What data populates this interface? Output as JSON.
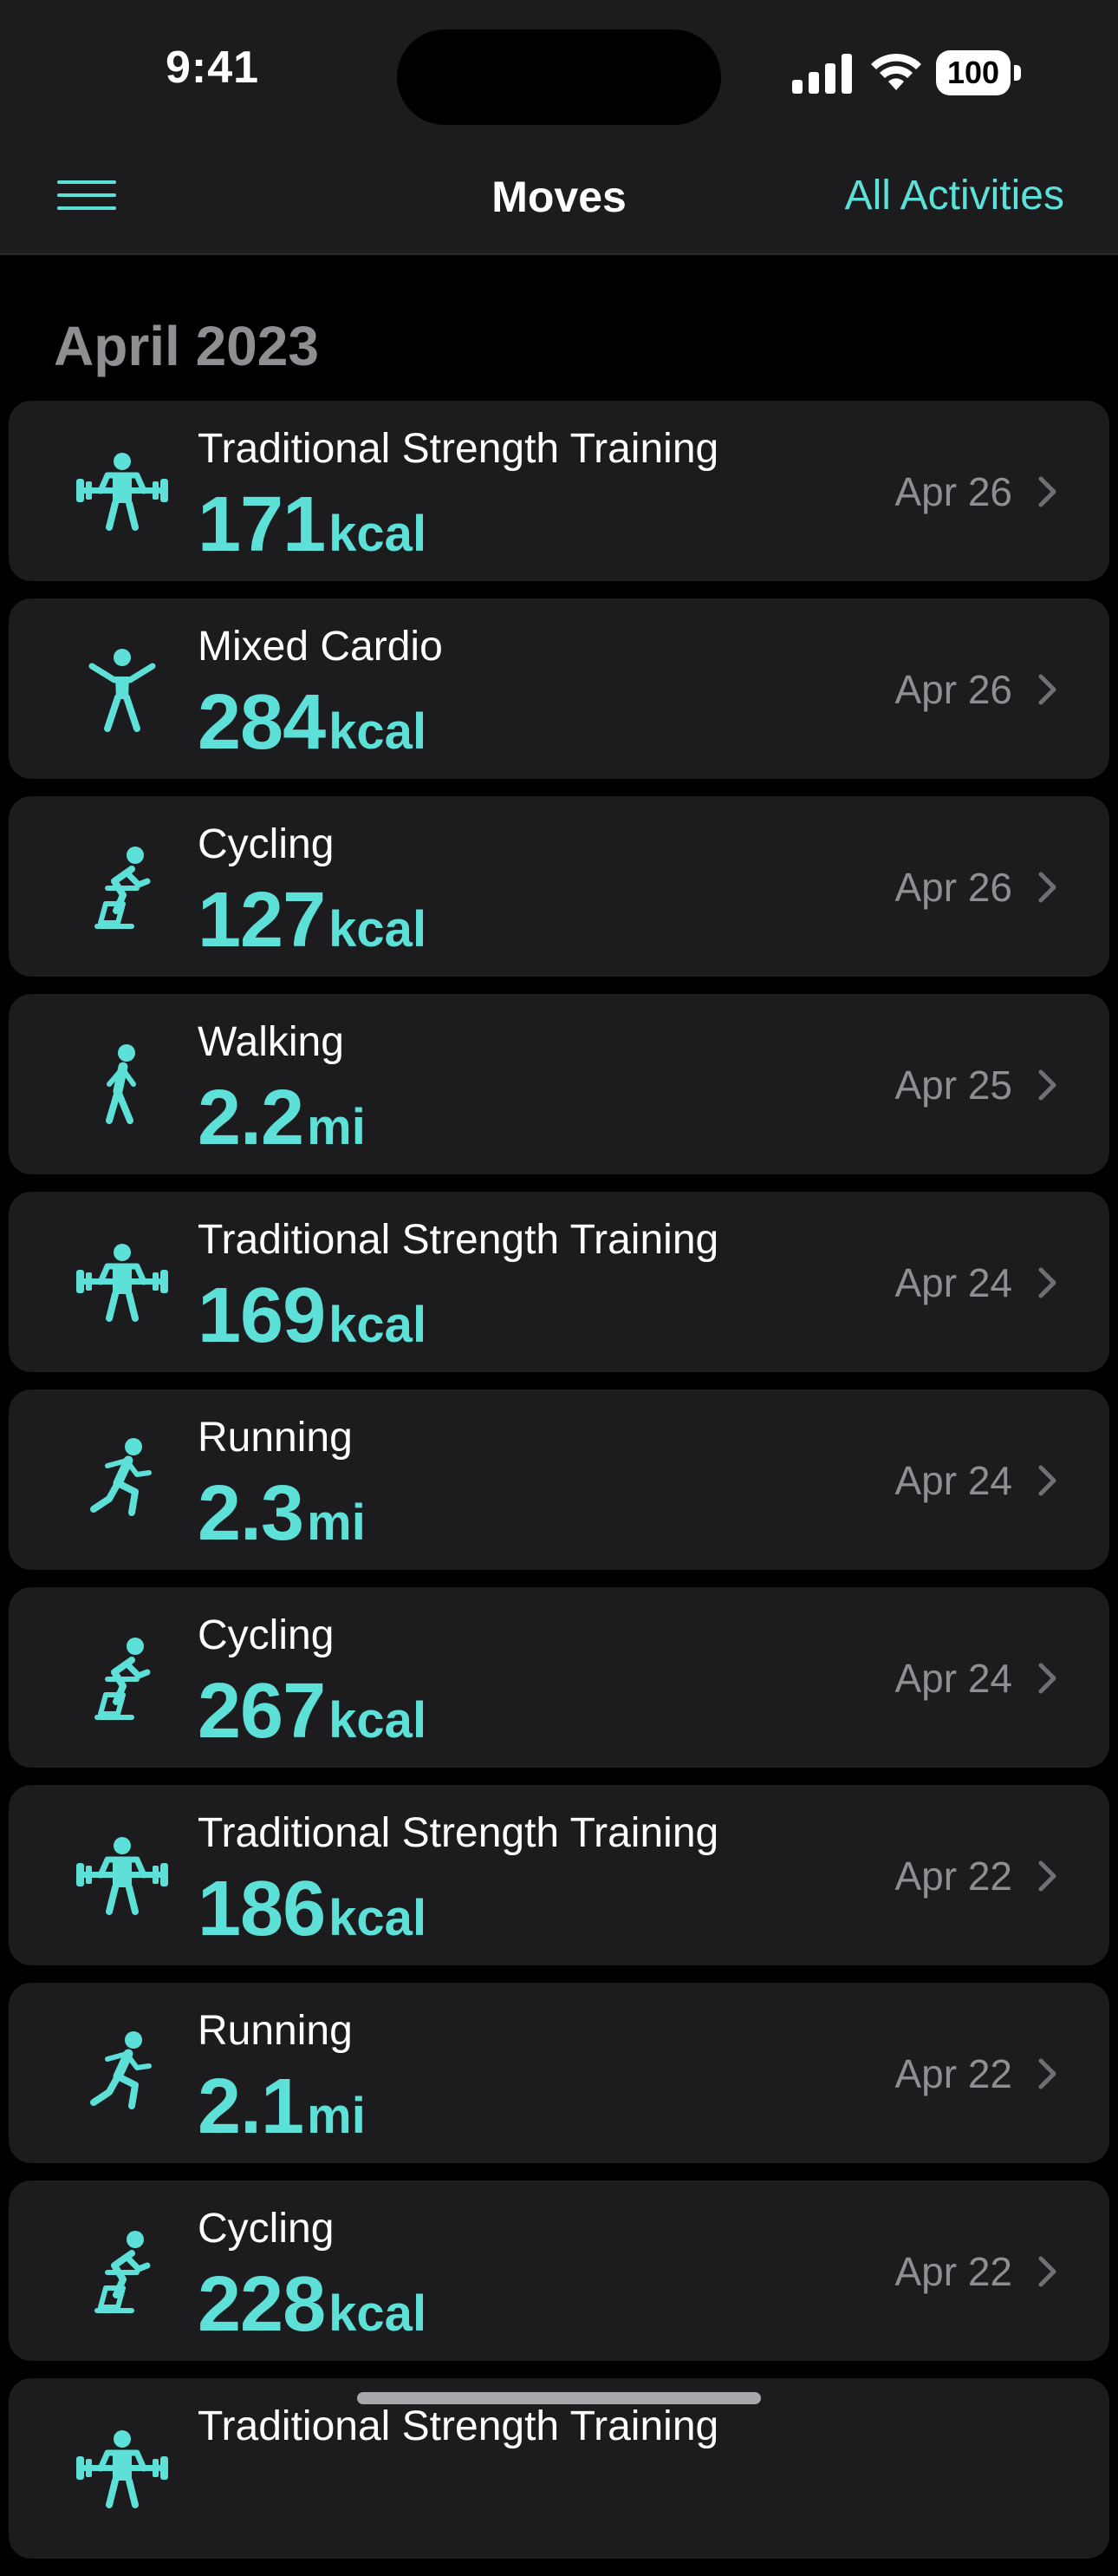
{
  "status_bar": {
    "time": "9:41",
    "battery": "100"
  },
  "nav": {
    "title": "Moves",
    "action_label": "All Activities"
  },
  "section": {
    "header": "April 2023"
  },
  "activities": [
    {
      "icon": "strength-training-icon",
      "title": "Traditional Strength Training",
      "value": "171",
      "unit": "kcal",
      "date": "Apr 26"
    },
    {
      "icon": "mixed-cardio-icon",
      "title": "Mixed Cardio",
      "value": "284",
      "unit": "kcal",
      "date": "Apr 26"
    },
    {
      "icon": "cycling-icon",
      "title": "Cycling",
      "value": "127",
      "unit": "kcal",
      "date": "Apr 26"
    },
    {
      "icon": "walking-icon",
      "title": "Walking",
      "value": "2.2",
      "unit": "mi",
      "date": "Apr 25"
    },
    {
      "icon": "strength-training-icon",
      "title": "Traditional Strength Training",
      "value": "169",
      "unit": "kcal",
      "date": "Apr 24"
    },
    {
      "icon": "running-icon",
      "title": "Running",
      "value": "2.3",
      "unit": "mi",
      "date": "Apr 24"
    },
    {
      "icon": "cycling-icon",
      "title": "Cycling",
      "value": "267",
      "unit": "kcal",
      "date": "Apr 24"
    },
    {
      "icon": "strength-training-icon",
      "title": "Traditional Strength Training",
      "value": "186",
      "unit": "kcal",
      "date": "Apr 22"
    },
    {
      "icon": "running-icon",
      "title": "Running",
      "value": "2.1",
      "unit": "mi",
      "date": "Apr 22"
    },
    {
      "icon": "cycling-icon",
      "title": "Cycling",
      "value": "228",
      "unit": "kcal",
      "date": "Apr 22"
    },
    {
      "icon": "strength-training-icon",
      "title": "Traditional Strength Training",
      "value": "",
      "unit": "",
      "date": ""
    }
  ],
  "colors": {
    "accent": "#5de0d8",
    "background": "#000000",
    "card": "#1c1c1e",
    "secondary_text": "#8e8e93"
  }
}
